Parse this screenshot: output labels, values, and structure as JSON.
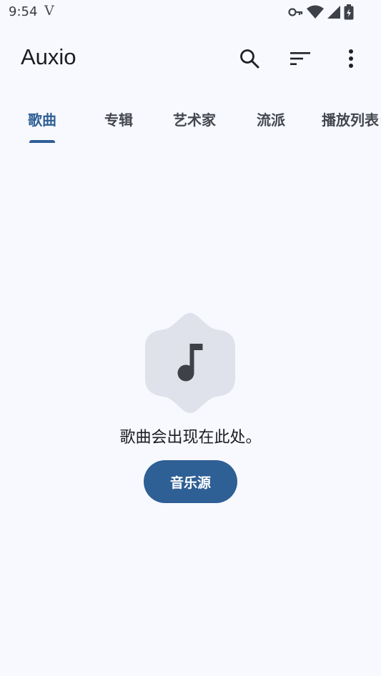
{
  "status_bar": {
    "time": "9:54",
    "carrier_glyph": "V",
    "icons": [
      "vpn-key-icon",
      "wifi-icon",
      "cell-signal-icon",
      "battery-charging-icon"
    ]
  },
  "app_bar": {
    "title": "Auxio",
    "actions": [
      "search-icon",
      "sort-icon",
      "more-vert-icon"
    ]
  },
  "tabs": [
    {
      "label": "歌曲",
      "active": true
    },
    {
      "label": "专辑",
      "active": false
    },
    {
      "label": "艺术家",
      "active": false
    },
    {
      "label": "流派",
      "active": false
    },
    {
      "label": "播放列表",
      "active": false
    }
  ],
  "empty_state": {
    "icon": "music-note-icon",
    "message": "歌曲会出现在此处。",
    "button_label": "音乐源"
  },
  "colors": {
    "background": "#f7f9ff",
    "accent": "#2e5f95",
    "shape": "#dfe2ea",
    "icon": "#3f4148"
  }
}
